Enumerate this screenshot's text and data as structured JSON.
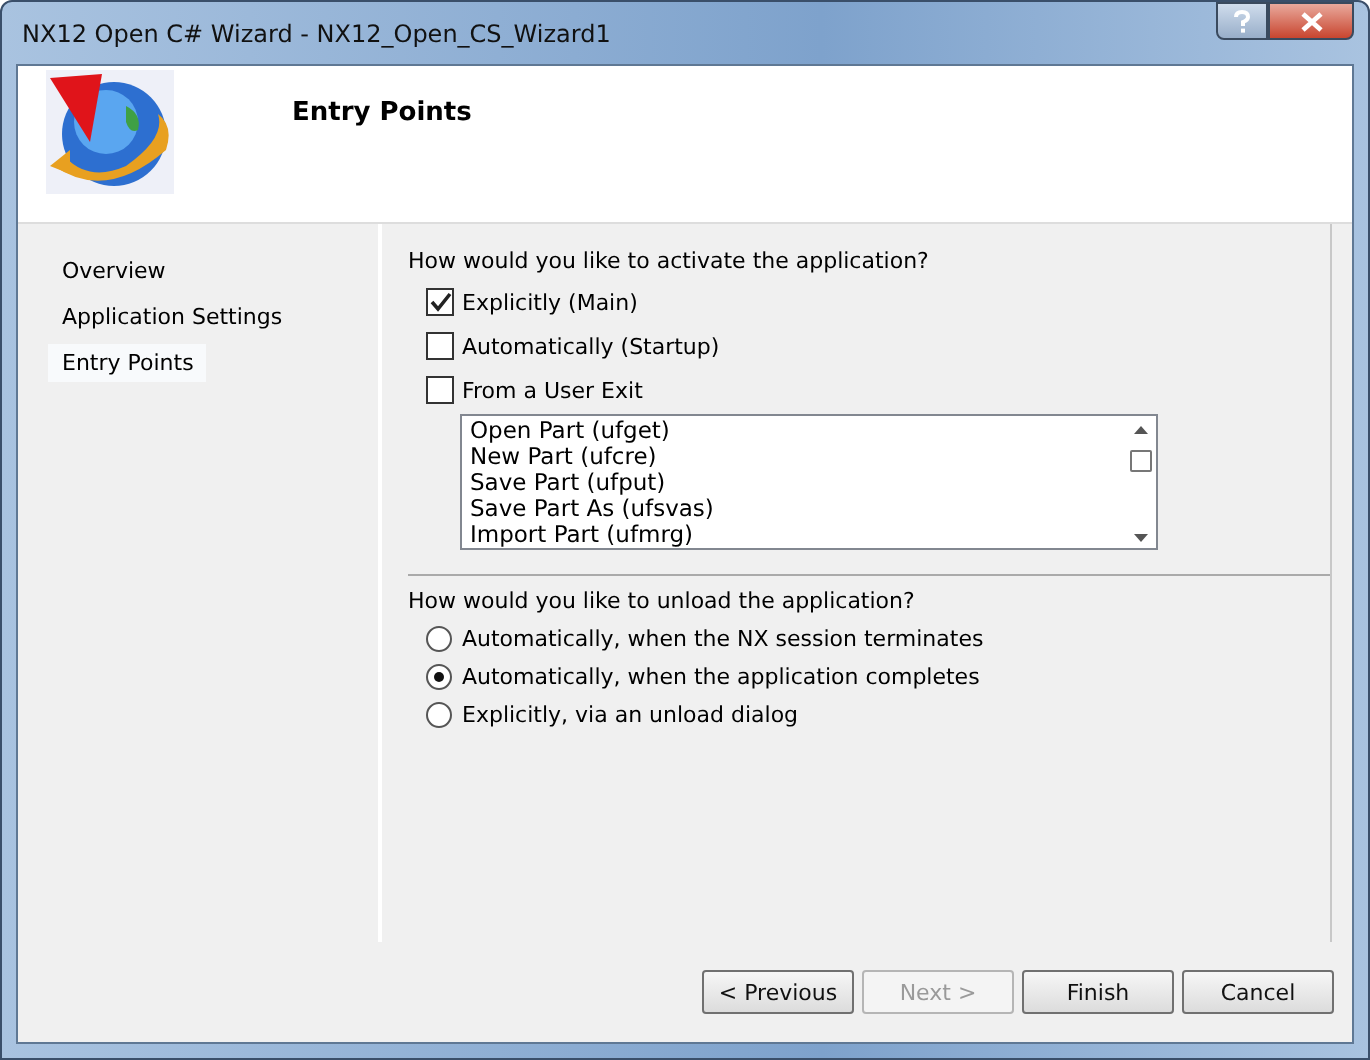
{
  "window": {
    "title": "NX12 Open C# Wizard - NX12_Open_CS_Wizard1"
  },
  "header": {
    "title": "Entry Points"
  },
  "sidebar": {
    "items": [
      {
        "label": "Overview",
        "selected": false
      },
      {
        "label": "Application Settings",
        "selected": false
      },
      {
        "label": "Entry Points",
        "selected": true
      }
    ]
  },
  "activate": {
    "question": "How would you like to activate the application?",
    "options": [
      {
        "label": "Explicitly (Main)",
        "checked": true
      },
      {
        "label": "Automatically (Startup)",
        "checked": false
      },
      {
        "label": "From a User Exit",
        "checked": false
      }
    ],
    "exits": [
      "Open Part (ufget)",
      "New Part (ufcre)",
      "Save Part (ufput)",
      "Save Part As (ufsvas)",
      "Import Part (ufmrg)"
    ]
  },
  "unload": {
    "question": "How would you like to unload the application?",
    "options": [
      {
        "label": "Automatically, when the  NX session terminates",
        "selected": false
      },
      {
        "label": "Automatically, when the application completes",
        "selected": true
      },
      {
        "label": "Explicitly, via an unload dialog",
        "selected": false
      }
    ]
  },
  "buttons": [
    {
      "label": "< Previous",
      "disabled": false
    },
    {
      "label": "Next >",
      "disabled": true
    },
    {
      "label": "Finish",
      "disabled": false
    },
    {
      "label": "Cancel",
      "disabled": false
    }
  ]
}
